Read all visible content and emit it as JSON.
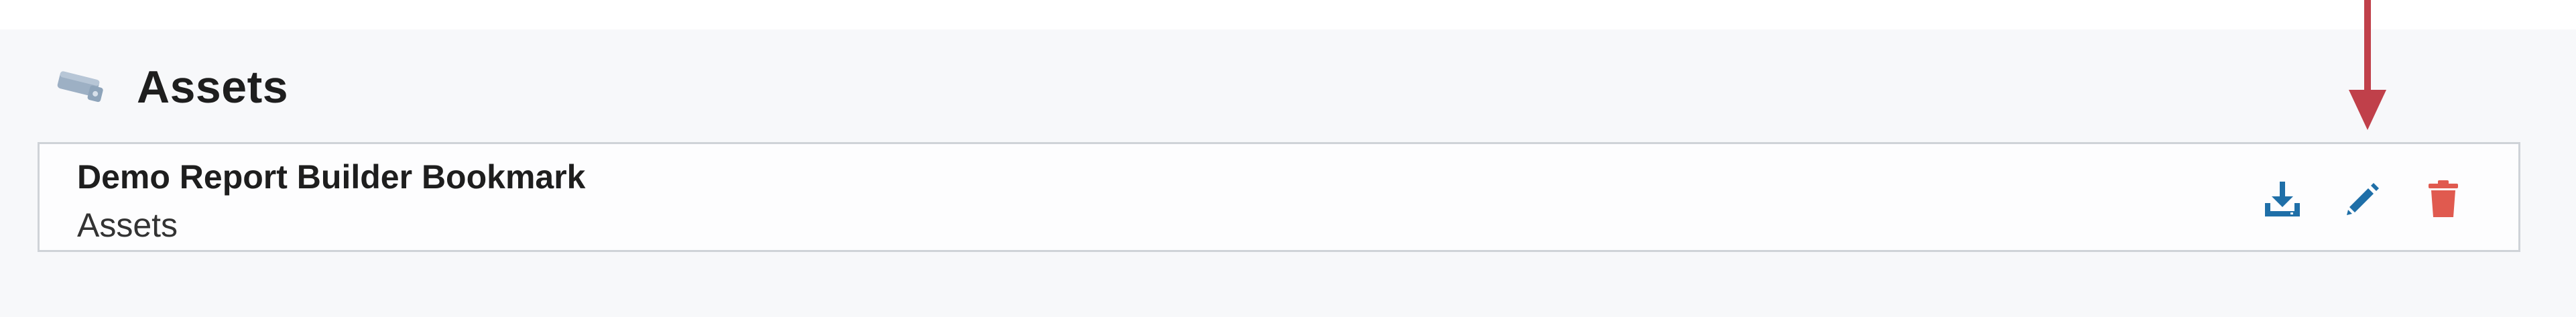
{
  "section": {
    "title": "Assets",
    "icon": "assets-icon"
  },
  "bookmark": {
    "title": "Demo Report Builder Bookmark",
    "subtitle": "Assets"
  },
  "actions": {
    "download_icon": "download-icon",
    "edit_icon": "pencil-icon",
    "delete_icon": "trash-icon"
  },
  "colors": {
    "action_blue": "#1f6fa8",
    "delete_red": "#e05a4f",
    "annotation_arrow": "#c0404a",
    "header_icon": "#9db0c4"
  }
}
